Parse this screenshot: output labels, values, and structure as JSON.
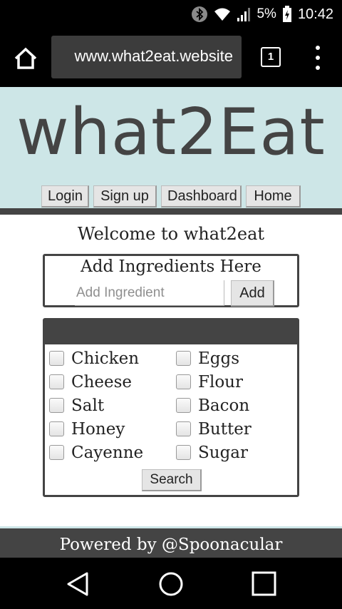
{
  "status_bar": {
    "battery": "5%",
    "time": "10:42",
    "icons": [
      "bluetooth-icon",
      "wifi-icon",
      "signal-icon",
      "battery-charging-icon"
    ]
  },
  "browser": {
    "url": "www.what2eat.website",
    "tab_count": "1",
    "icons": [
      "home-icon",
      "menu-dots-icon"
    ]
  },
  "site": {
    "title": "what2Eat",
    "nav": [
      "Login",
      "Sign up",
      "Dashboard",
      "Home"
    ],
    "welcome": "Welcome to what2eat",
    "add": {
      "title": "Add Ingredients Here",
      "placeholder": "Add Ingredient",
      "button": "Add"
    },
    "ingredients": [
      "Chicken",
      "Eggs",
      "Cheese",
      "Flour",
      "Salt",
      "Bacon",
      "Honey",
      "Butter",
      "Cayenne",
      "Sugar"
    ],
    "search_button": "Search",
    "footer": "Powered by @Spoonacular"
  },
  "colors": {
    "hero_bg": "#cde6e7",
    "dark": "#444444"
  },
  "system_nav": [
    "back-icon",
    "home-circle-icon",
    "recents-icon"
  ]
}
